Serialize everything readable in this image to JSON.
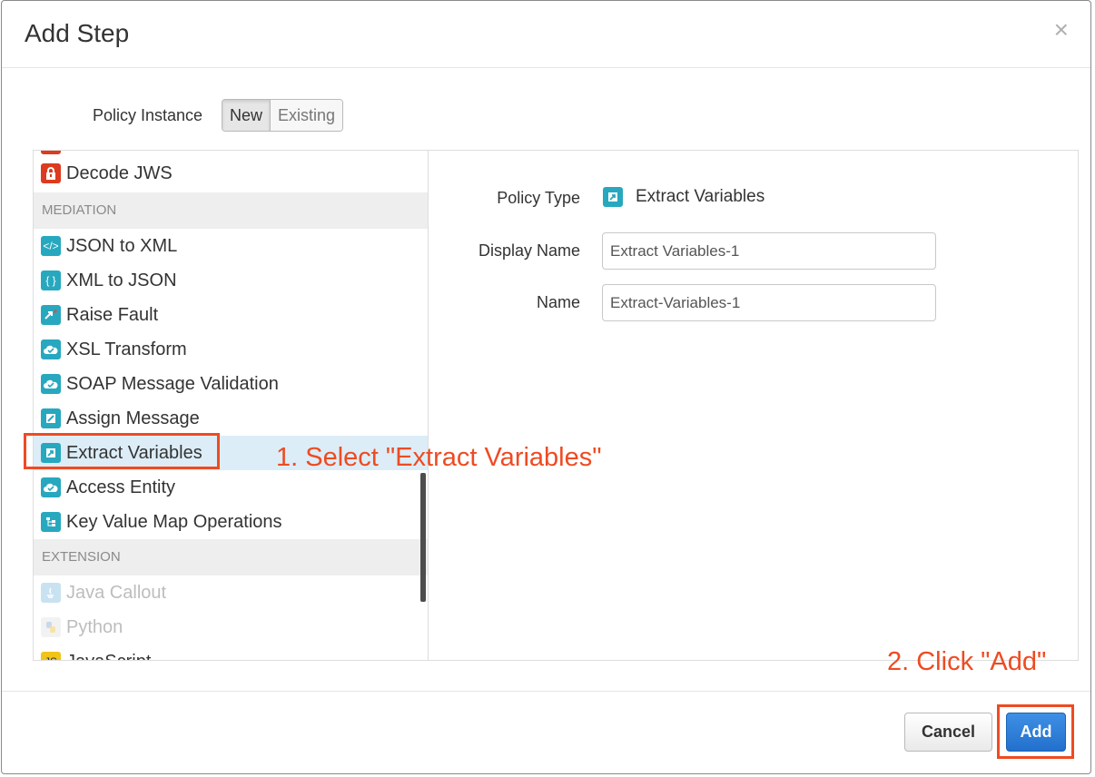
{
  "dialog": {
    "title": "Add Step",
    "close_symbol": "×"
  },
  "policy_instance": {
    "label": "Policy Instance",
    "options": [
      "New",
      "Existing"
    ],
    "selected": "New"
  },
  "list": {
    "items": [
      {
        "label": "Decode JWS",
        "icon": "lock-icon",
        "color": "#dd3b1f"
      },
      {
        "label": "MEDIATION",
        "section": true
      },
      {
        "label": "JSON to XML",
        "icon": "code-icon",
        "color": "#27a8bf"
      },
      {
        "label": "XML to JSON",
        "icon": "braces-icon",
        "color": "#27a8bf"
      },
      {
        "label": "Raise Fault",
        "icon": "fault-icon",
        "color": "#27a8bf"
      },
      {
        "label": "XSL Transform",
        "icon": "cloud-check-icon",
        "color": "#27a8bf"
      },
      {
        "label": "SOAP Message Validation",
        "icon": "cloud-check-icon",
        "color": "#27a8bf"
      },
      {
        "label": "Assign Message",
        "icon": "pencil-icon",
        "color": "#27a8bf"
      },
      {
        "label": "Extract Variables",
        "icon": "extract-icon",
        "color": "#27a8bf",
        "selected": true
      },
      {
        "label": "Access Entity",
        "icon": "cloud-check-icon",
        "color": "#27a8bf"
      },
      {
        "label": "Key Value Map Operations",
        "icon": "tree-icon",
        "color": "#27a8bf"
      },
      {
        "label": "EXTENSION",
        "section": true
      },
      {
        "label": "Java Callout",
        "icon": "java-icon",
        "disabled": true
      },
      {
        "label": "Python",
        "icon": "python-icon",
        "disabled": true
      },
      {
        "label": "JavaScript",
        "icon": "js-icon",
        "color": "#f0c419"
      }
    ]
  },
  "form": {
    "policy_type_label": "Policy Type",
    "policy_type_value": "Extract Variables",
    "display_name_label": "Display Name",
    "display_name_value": "Extract Variables-1",
    "name_label": "Name",
    "name_value": "Extract-Variables-1"
  },
  "annotations": {
    "step1": "1. Select \"Extract Variables\"",
    "step2": "2. Click \"Add\""
  },
  "footer": {
    "cancel_label": "Cancel",
    "add_label": "Add"
  },
  "colors": {
    "accent_annotation": "#ee4b22",
    "primary_button": "#2270cc",
    "selected_row": "#dcedf7",
    "icon_teal": "#27a8bf"
  }
}
